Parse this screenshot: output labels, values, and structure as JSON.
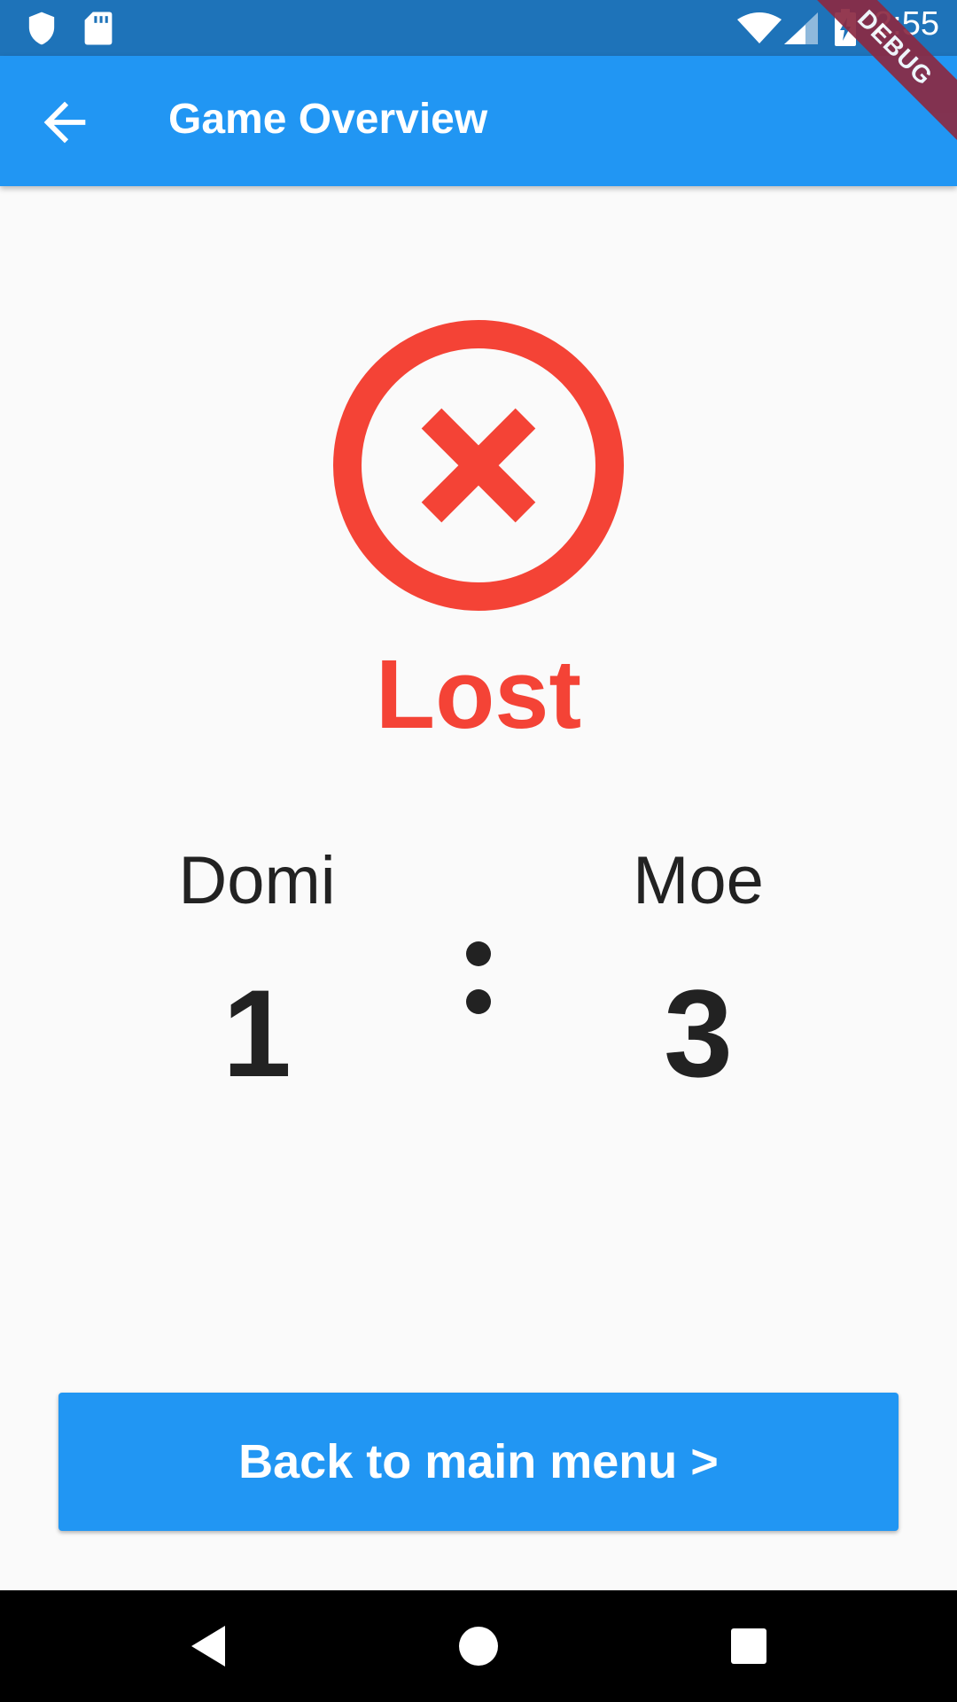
{
  "status_bar": {
    "time": "2:55",
    "icons": [
      "shield-icon",
      "sd-card-icon",
      "wifi-icon",
      "signal-icon",
      "battery-charging-icon"
    ]
  },
  "app_bar": {
    "title": "Game Overview",
    "back_icon": "arrow-back-icon",
    "debug_banner": "DEBUG"
  },
  "result": {
    "icon": "cancel-circle-icon",
    "label": "Lost",
    "color": "#f44336"
  },
  "players": [
    {
      "name": "Domi",
      "score": "1"
    },
    {
      "name": "Moe",
      "score": "3"
    }
  ],
  "actions": {
    "back_to_menu_label": "Back to main menu >"
  },
  "nav_bar": {
    "icons": [
      "back-triangle-icon",
      "home-circle-icon",
      "recents-square-icon"
    ]
  },
  "colors": {
    "primary": "#2196f3",
    "status_bar": "#1e73b9",
    "lost": "#f44336",
    "text": "#222222"
  }
}
